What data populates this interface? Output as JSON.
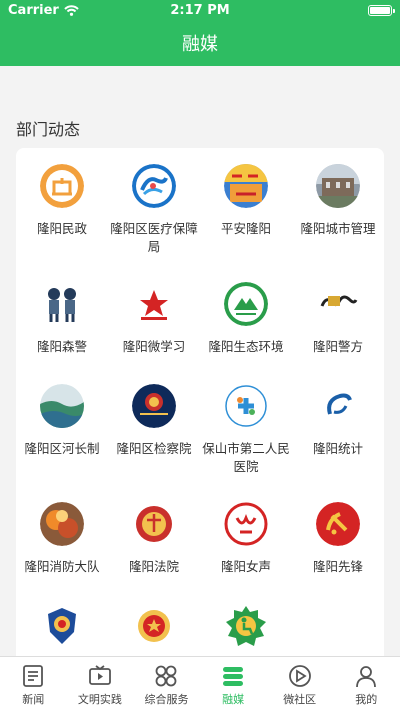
{
  "status": {
    "carrier": "Carrier",
    "time": "2:17 PM"
  },
  "nav": {
    "title": "融媒"
  },
  "section": {
    "title": "部门动态"
  },
  "departments": [
    {
      "label": "隆阳民政",
      "icon": "civil-affairs-logo-icon"
    },
    {
      "label": "隆阳区医疗保障局",
      "icon": "medical-security-logo-icon"
    },
    {
      "label": "平安隆阳",
      "icon": "safe-longyang-logo-icon"
    },
    {
      "label": "隆阳城市管理",
      "icon": "city-management-logo-icon"
    },
    {
      "label": "隆阳森警",
      "icon": "forest-police-logo-icon"
    },
    {
      "label": "隆阳微学习",
      "icon": "micro-learning-logo-icon"
    },
    {
      "label": "隆阳生态环境",
      "icon": "ecology-environment-logo-icon"
    },
    {
      "label": "隆阳警方",
      "icon": "police-logo-icon"
    },
    {
      "label": "隆阳区河长制",
      "icon": "river-chief-logo-icon"
    },
    {
      "label": "隆阳区检察院",
      "icon": "procuratorate-logo-icon"
    },
    {
      "label": "保山市第二人民医院",
      "icon": "hospital-logo-icon"
    },
    {
      "label": "隆阳统计",
      "icon": "statistics-logo-icon"
    },
    {
      "label": "隆阳消防大队",
      "icon": "fire-brigade-logo-icon"
    },
    {
      "label": "隆阳法院",
      "icon": "court-logo-icon"
    },
    {
      "label": "隆阳女声",
      "icon": "womens-federation-logo-icon"
    },
    {
      "label": "隆阳先锋",
      "icon": "party-pioneer-logo-icon"
    },
    {
      "label": "",
      "icon": "public-security-logo-icon"
    },
    {
      "label": "",
      "icon": "police-emblem-logo-icon"
    },
    {
      "label": "",
      "icon": "disabled-federation-logo-icon"
    }
  ],
  "tabs": [
    {
      "label": "新闻",
      "icon": "news-icon"
    },
    {
      "label": "文明实践",
      "icon": "civilization-tv-icon"
    },
    {
      "label": "综合服务",
      "icon": "services-grid-icon"
    },
    {
      "label": "融媒",
      "icon": "media-stack-icon"
    },
    {
      "label": "微社区",
      "icon": "community-play-icon"
    },
    {
      "label": "我的",
      "icon": "profile-icon"
    }
  ],
  "colors": {
    "primary": "#2ebd62",
    "background": "#f3f3f3"
  }
}
